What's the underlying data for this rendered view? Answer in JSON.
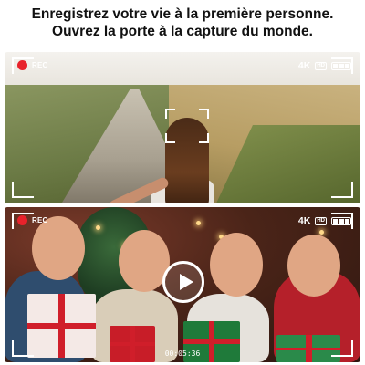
{
  "headline": {
    "line1": "Enregistrez votre vie à la première personne.",
    "line2": "Ouvrez la porte à la capture du monde."
  },
  "panels": [
    {
      "rec_label": "REC",
      "quality": "4K",
      "quality_badge": "HD",
      "battery_icon": "battery-icon",
      "scene": "first-person-walk-photo"
    },
    {
      "rec_label": "REC",
      "quality": "4K",
      "quality_badge": "HD",
      "battery_icon": "battery-icon",
      "scene": "friends-christmas-video",
      "play_icon": "play-icon",
      "timecode": "00:05:36"
    }
  ],
  "colors": {
    "rec": "#e8222b",
    "overlay": "#ffffff"
  }
}
